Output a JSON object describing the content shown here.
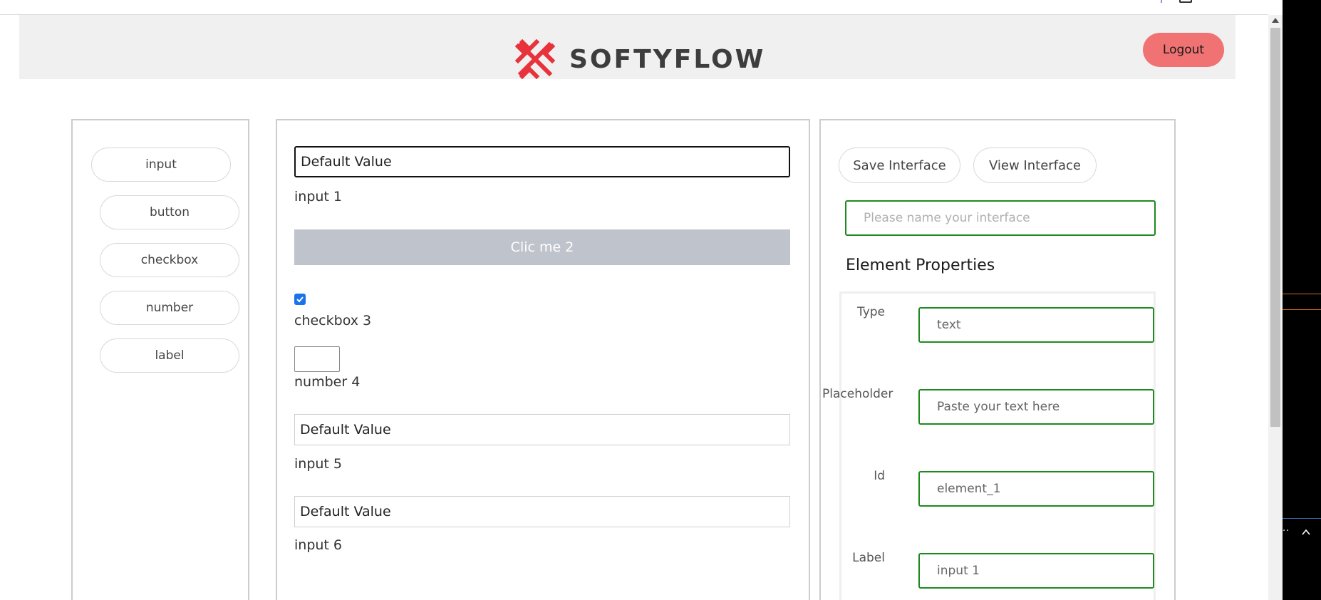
{
  "header": {
    "brand_name": "SOFTYFLOW",
    "logout_label": "Logout",
    "brand_color": "#e8323c",
    "logout_color": "#f07272"
  },
  "toolbox": {
    "items": [
      {
        "label": "input"
      },
      {
        "label": "button"
      },
      {
        "label": "checkbox"
      },
      {
        "label": "number"
      },
      {
        "label": "label"
      }
    ]
  },
  "canvas": {
    "input1": {
      "value": "Default Value",
      "label": "input 1"
    },
    "button2": {
      "text": "Clic me 2"
    },
    "checkbox3": {
      "checked": true,
      "label": "checkbox 3"
    },
    "number4": {
      "value": "",
      "label": "number 4"
    },
    "input5": {
      "value": "Default Value",
      "label": "input 5"
    },
    "input6": {
      "value": "Default Value",
      "label": "input 6"
    }
  },
  "properties_panel": {
    "save_label": "Save Interface",
    "view_label": "View Interface",
    "name_placeholder": "Please name your interface",
    "section_title": "Element Properties",
    "fields": [
      {
        "label": "Type",
        "value": "text"
      },
      {
        "label": "Placeholder",
        "value": "Paste your text here"
      },
      {
        "label": "Id",
        "value": "element_1"
      },
      {
        "label": "Label",
        "value": "input 1"
      }
    ],
    "field_border_color": "#1e8a1e"
  },
  "icons": {
    "logo": "softyflow-x-logo-icon",
    "checkbox_check": "check-icon",
    "scroll_up": "scroll-up-arrow-icon",
    "tray": "chevron-up-icon"
  }
}
